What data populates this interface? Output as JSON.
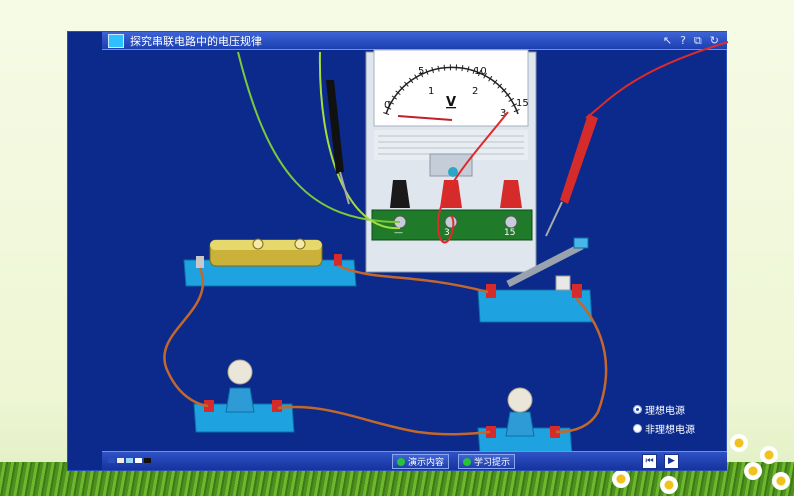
{
  "window": {
    "title": "探究串联电路中的电压规律"
  },
  "title_controls": [
    "↖",
    "?",
    "⧉",
    "↻"
  ],
  "meter": {
    "unit": "V",
    "upper_scale": [
      "0",
      "5",
      "10",
      "15"
    ],
    "lower_scale": [
      "1",
      "2",
      "3"
    ],
    "terminals": [
      "—",
      "3",
      "15"
    ]
  },
  "options": {
    "ideal_source": "理想电源",
    "non_ideal_source": "非理想电源",
    "selected": "ideal_source"
  },
  "toolbar": {
    "swatches": [
      "#2b4fb8",
      "#f2ece0",
      "#9ad7f5",
      "#ffffff",
      "#111111"
    ],
    "demo_label": "演示内容",
    "hint_label": "学习提示",
    "prev_glyph": "⏮",
    "next_glyph": "▶"
  },
  "icons": {
    "app": "app-logo-icon",
    "voltmeter": "voltmeter-icon",
    "battery": "battery-icon",
    "switch": "knife-switch-icon",
    "bulb": "light-bulb-icon"
  }
}
